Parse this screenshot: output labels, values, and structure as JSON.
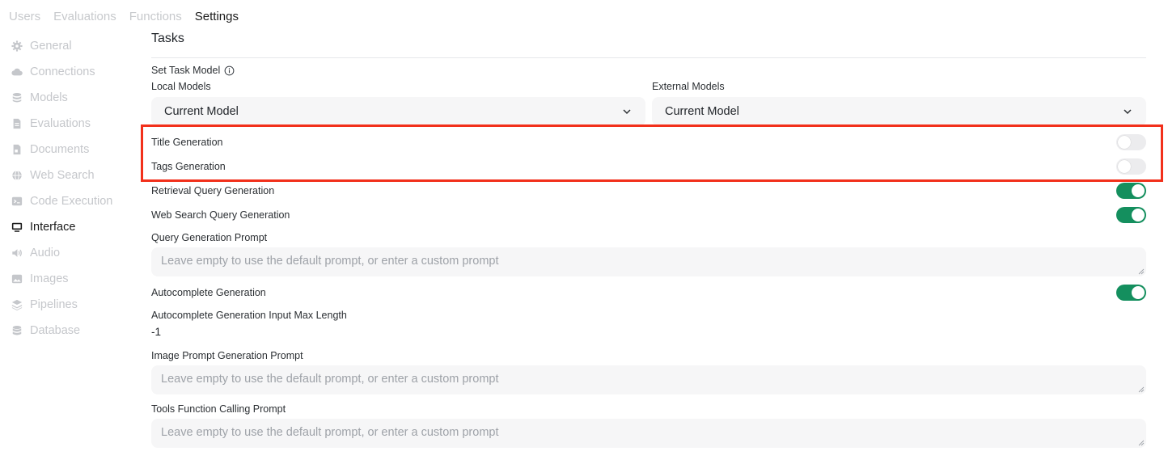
{
  "top_tabs": [
    "Users",
    "Evaluations",
    "Functions",
    "Settings"
  ],
  "active_tab": "Settings",
  "sidebar": {
    "items": [
      {
        "label": "General",
        "icon": "gear-icon"
      },
      {
        "label": "Connections",
        "icon": "cloud-icon"
      },
      {
        "label": "Models",
        "icon": "stack-icon"
      },
      {
        "label": "Evaluations",
        "icon": "document-icon"
      },
      {
        "label": "Documents",
        "icon": "document-icon"
      },
      {
        "label": "Web Search",
        "icon": "globe-icon"
      },
      {
        "label": "Code Execution",
        "icon": "terminal-icon"
      },
      {
        "label": "Interface",
        "icon": "monitor-icon"
      },
      {
        "label": "Audio",
        "icon": "speaker-icon"
      },
      {
        "label": "Images",
        "icon": "image-icon"
      },
      {
        "label": "Pipelines",
        "icon": "layers-icon"
      },
      {
        "label": "Database",
        "icon": "database-icon"
      }
    ],
    "active": "Interface"
  },
  "main": {
    "section_title": "Tasks",
    "set_task_model_label": "Set Task Model",
    "local_models_label": "Local Models",
    "external_models_label": "External Models",
    "local_model_value": "Current Model",
    "external_model_value": "Current Model",
    "toggles": [
      {
        "label": "Title Generation",
        "on": false
      },
      {
        "label": "Tags Generation",
        "on": false
      },
      {
        "label": "Retrieval Query Generation",
        "on": true
      },
      {
        "label": "Web Search Query Generation",
        "on": true
      }
    ],
    "query_prompt_label": "Query Generation Prompt",
    "query_prompt_placeholder": "Leave empty to use the default prompt, or enter a custom prompt",
    "autocomplete_label": "Autocomplete Generation",
    "autocomplete_on": true,
    "autocomplete_max_length_label": "Autocomplete Generation Input Max Length",
    "autocomplete_max_length_value": "-1",
    "image_prompt_label": "Image Prompt Generation Prompt",
    "image_prompt_placeholder": "Leave empty to use the default prompt, or enter a custom prompt",
    "tools_prompt_label": "Tools Function Calling Prompt",
    "tools_prompt_placeholder": "Leave empty to use the default prompt, or enter a custom prompt"
  },
  "colors": {
    "toggle_on": "#148f5e",
    "highlight": "#f2301b"
  }
}
